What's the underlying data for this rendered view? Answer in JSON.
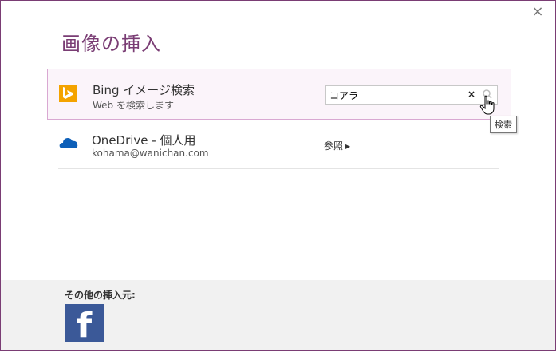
{
  "dialog": {
    "title": "画像の挿入",
    "close_label": "×"
  },
  "bing": {
    "name": "Bing イメージ検索",
    "subtitle": "Web を検索します",
    "search_value": "コアラ",
    "clear_label": "×",
    "tooltip": "検索"
  },
  "onedrive": {
    "name": "OneDrive - 個人用",
    "account": "kohama@wanichan.com",
    "browse_label": "参照"
  },
  "footer": {
    "label": "その他の挿入元:",
    "facebook_glyph": "f"
  },
  "colors": {
    "accent": "#7a3d74",
    "bing_orange": "#f4a300",
    "onedrive_blue": "#0d5fb8",
    "facebook_blue": "#3b5998"
  }
}
